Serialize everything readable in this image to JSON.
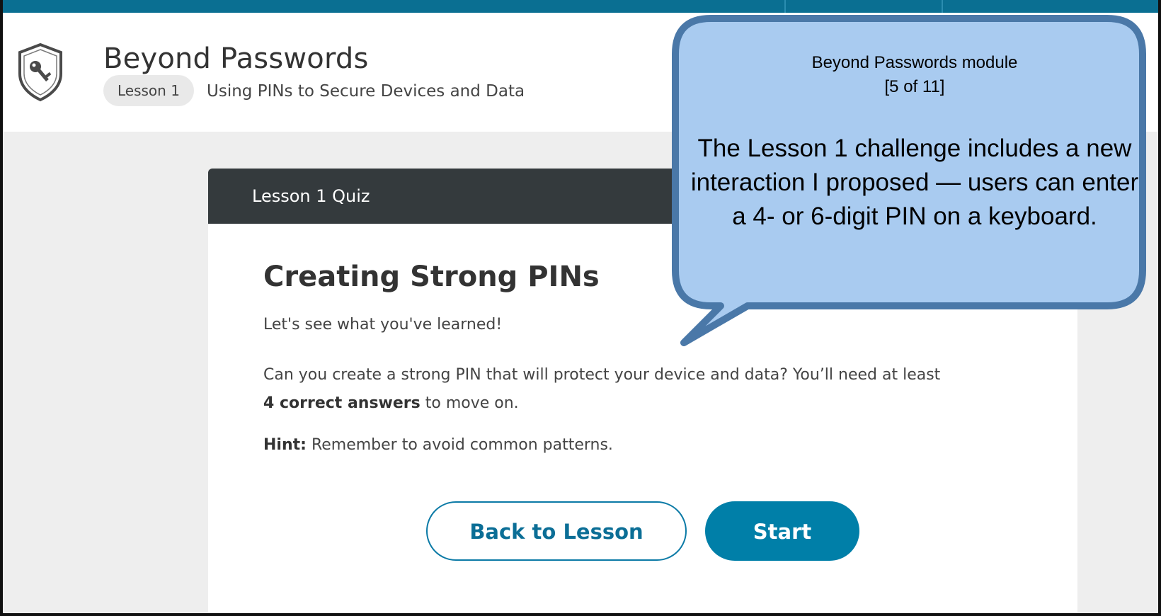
{
  "header": {
    "app_title": "Beyond Passwords",
    "lesson_badge": "Lesson 1",
    "lesson_title": "Using PINs to Secure Devices and Data",
    "logo_icon": "shield-key-icon"
  },
  "card": {
    "header_title": "Lesson 1 Quiz",
    "title": "Creating Strong PINs",
    "intro": "Let's see what you've learned!",
    "desc_part1": "Can you create a strong PIN that will protect your device and data? You’ll need at least",
    "desc_bold": "4 correct answers",
    "desc_part2": "to move on.",
    "hint_label": "Hint:",
    "hint_text": "Remember to avoid common patterns.",
    "back_button": "Back to Lesson",
    "start_button": "Start"
  },
  "callout": {
    "module_line": "Beyond Passwords module",
    "progress": "[5 of 11]",
    "body": "The Lesson 1 challenge includes a new interaction I proposed — users can enter a 4- or 6-digit PIN on a keyboard."
  },
  "colors": {
    "top_bar": "#0a6f92",
    "card_header": "#343a3d",
    "primary_button": "#007fa8",
    "callout_fill": "#a9cbf0",
    "callout_border": "#4a78a8"
  }
}
